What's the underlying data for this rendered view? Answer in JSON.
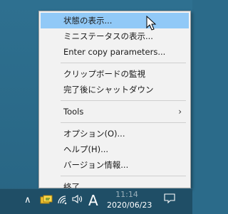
{
  "menu": {
    "items": [
      {
        "label": "状態の表示...",
        "highlighted": true
      },
      {
        "label": "ミニステータスの表示..."
      },
      {
        "label": "Enter copy parameters..."
      },
      {
        "label": "クリップボードの監視"
      },
      {
        "label": "完了後にシャットダウン"
      },
      {
        "label": "Tools",
        "submenu": true
      },
      {
        "label": "オプション(O)..."
      },
      {
        "label": "ヘルプ(H)..."
      },
      {
        "label": "バージョン情報..."
      },
      {
        "label": "終了"
      }
    ],
    "highlight_color": "#91c9f7"
  },
  "taskbar": {
    "ime_label": "A",
    "time": "11:14",
    "date": "2020/06/23",
    "icons": [
      "chevron-up-icon",
      "app-tray-icon",
      "network-icon",
      "speaker-icon",
      "notification-icon"
    ]
  }
}
